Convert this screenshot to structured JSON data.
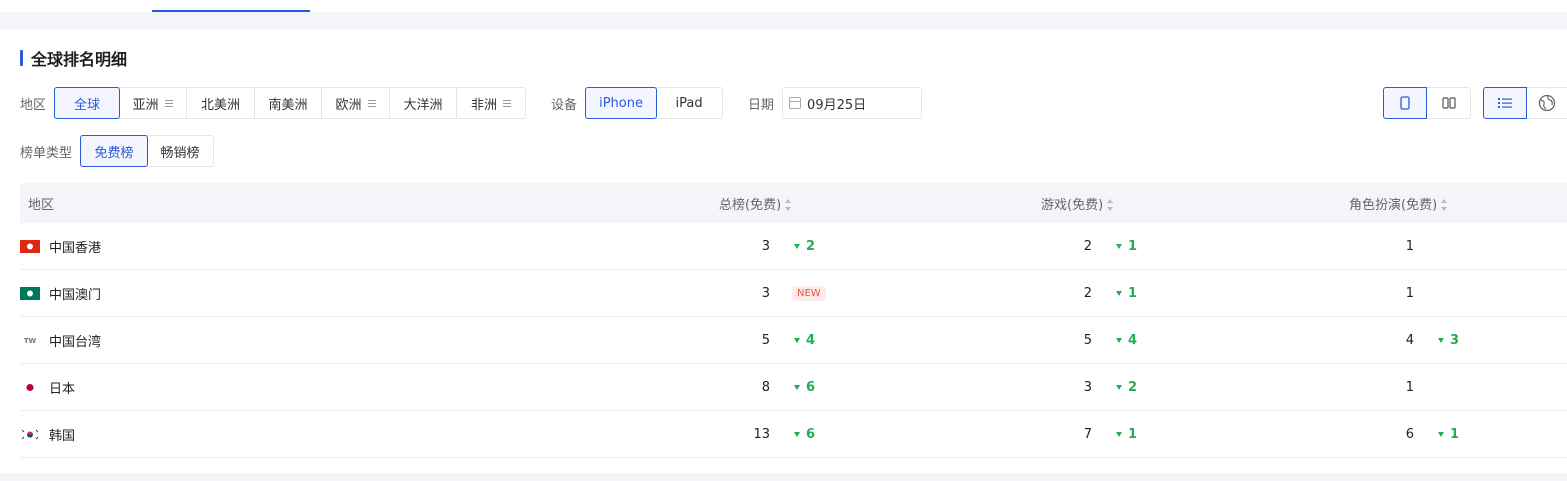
{
  "section_title": "全球排名明细",
  "filters": {
    "region_label": "地区",
    "regions": [
      {
        "label": "全球",
        "active": true,
        "menu": false
      },
      {
        "label": "亚洲",
        "active": false,
        "menu": true
      },
      {
        "label": "北美洲",
        "active": false,
        "menu": false
      },
      {
        "label": "南美洲",
        "active": false,
        "menu": false
      },
      {
        "label": "欧洲",
        "active": false,
        "menu": true
      },
      {
        "label": "大洋洲",
        "active": false,
        "menu": false
      },
      {
        "label": "非洲",
        "active": false,
        "menu": true
      }
    ],
    "device_label": "设备",
    "devices": [
      {
        "label": "iPhone",
        "active": true
      },
      {
        "label": "iPad",
        "active": false
      }
    ],
    "date_label": "日期",
    "date_value": "09月25日",
    "chart_type_label": "榜单类型",
    "chart_types": [
      {
        "label": "免费榜",
        "active": true
      },
      {
        "label": "畅销榜",
        "active": false
      }
    ]
  },
  "toolbar": {
    "icons": [
      "phone-view-icon",
      "columns-view-icon",
      "list-view-icon",
      "globe-view-icon"
    ],
    "active": [
      "phone-view-icon",
      "list-view-icon"
    ]
  },
  "table": {
    "headers": [
      "地区",
      "总榜(免费)",
      "游戏(免费)",
      "角色扮演(免费)"
    ],
    "rows": [
      {
        "region": "中国香港",
        "flag": "hk",
        "total": {
          "rank": "3",
          "change": "2",
          "new": false
        },
        "games": {
          "rank": "2",
          "change": "1",
          "new": false
        },
        "rpg": {
          "rank": "1",
          "change": "",
          "new": false
        }
      },
      {
        "region": "中国澳门",
        "flag": "mo",
        "total": {
          "rank": "3",
          "change": "",
          "new": true,
          "new_label": "NEW"
        },
        "games": {
          "rank": "2",
          "change": "1",
          "new": false
        },
        "rpg": {
          "rank": "1",
          "change": "",
          "new": false
        }
      },
      {
        "region": "中国台湾",
        "flag": "tw",
        "flag_text": "TW",
        "total": {
          "rank": "5",
          "change": "4",
          "new": false
        },
        "games": {
          "rank": "5",
          "change": "4",
          "new": false
        },
        "rpg": {
          "rank": "4",
          "change": "3",
          "new": false
        }
      },
      {
        "region": "日本",
        "flag": "jp",
        "total": {
          "rank": "8",
          "change": "6",
          "new": false
        },
        "games": {
          "rank": "3",
          "change": "2",
          "new": false
        },
        "rpg": {
          "rank": "1",
          "change": "",
          "new": false
        }
      },
      {
        "region": "韩国",
        "flag": "kr",
        "total": {
          "rank": "13",
          "change": "6",
          "new": false
        },
        "games": {
          "rank": "7",
          "change": "1",
          "new": false
        },
        "rpg": {
          "rank": "6",
          "change": "1",
          "new": false
        }
      }
    ]
  },
  "colors": {
    "accent": "#2a5bd7",
    "up_down": "#1fb04f",
    "new": "#e5533d"
  }
}
